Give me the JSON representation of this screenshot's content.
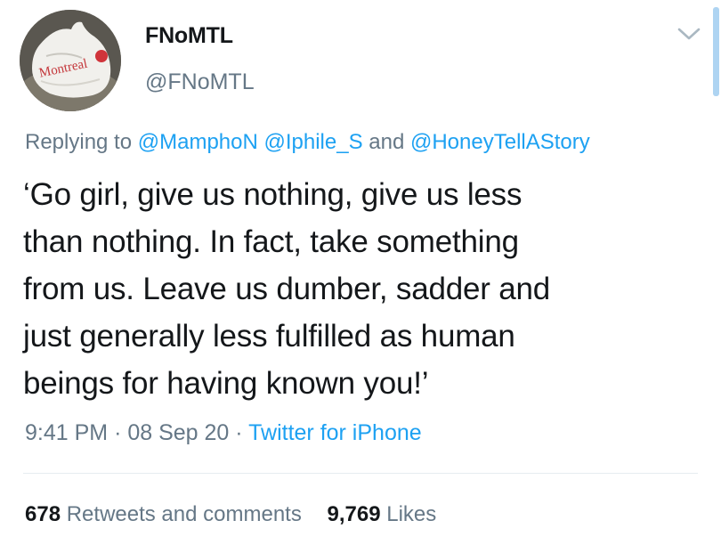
{
  "tweet": {
    "display_name": "FNoMTL",
    "handle": "@FNoMTL",
    "avatar_text": "Montreal",
    "reply": {
      "prefix": "Replying to",
      "mention_1": "@MamphoN",
      "mention_2": "@Iphile_S",
      "joiner": "and",
      "mention_3": "@HoneyTellAStory"
    },
    "text_lines": [
      "‘Go girl, give us nothing, give us less",
      "than nothing. In fact, take something",
      "from us. Leave us dumber, sadder and",
      "just generally less fulfilled as human",
      "beings for having known you!’"
    ],
    "time": "9:41 PM",
    "date": "08 Sep 20",
    "separator": "·",
    "source": "Twitter for iPhone",
    "stats": {
      "retweets_count": "678",
      "retweets_label": "Retweets and comments",
      "likes_count": "9,769",
      "likes_label": "Likes"
    }
  },
  "icons": {
    "more": "chevron-down-icon"
  },
  "colors": {
    "text": "#14171a",
    "secondary": "#657786",
    "link": "#1da1f2",
    "divider": "#e6ecf0"
  }
}
